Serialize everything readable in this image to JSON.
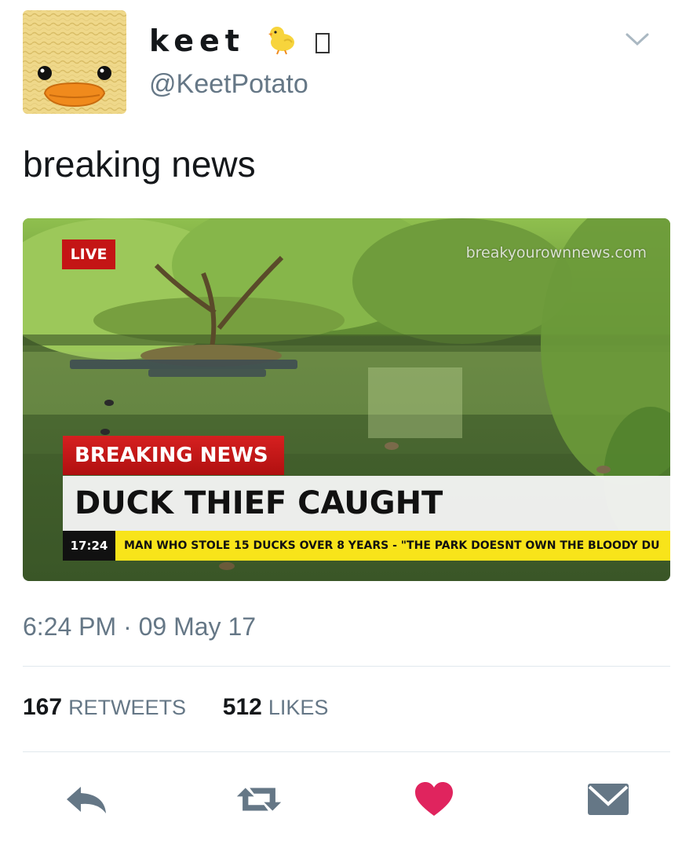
{
  "user": {
    "display_name": "keet",
    "handle": "@KeetPotato",
    "emoji_icon": "baby-chick-icon"
  },
  "tweet": {
    "text": "breaking news",
    "timestamp": "6:24 PM · 09 May 17"
  },
  "media": {
    "live_label": "LIVE",
    "watermark": "breakyourownnews.com",
    "banner": "BREAKING NEWS",
    "headline": "DUCK THIEF CAUGHT",
    "ticker_time": "17:24",
    "ticker_text": "MAN WHO STOLE 15 DUCKS OVER 8 YEARS - \"THE PARK DOESNT OWN THE BLOODY DU"
  },
  "stats": {
    "retweets": "167",
    "retweets_label": "RETWEETS",
    "likes": "512",
    "likes_label": "LIKES"
  },
  "actions": {
    "reply": "reply-icon",
    "retweet": "retweet-icon",
    "like": "heart-icon",
    "message": "envelope-icon"
  },
  "colors": {
    "like": "#e0245e",
    "muted": "#657786",
    "live_red": "#c41515",
    "ticker_yellow": "#f8e41a"
  }
}
